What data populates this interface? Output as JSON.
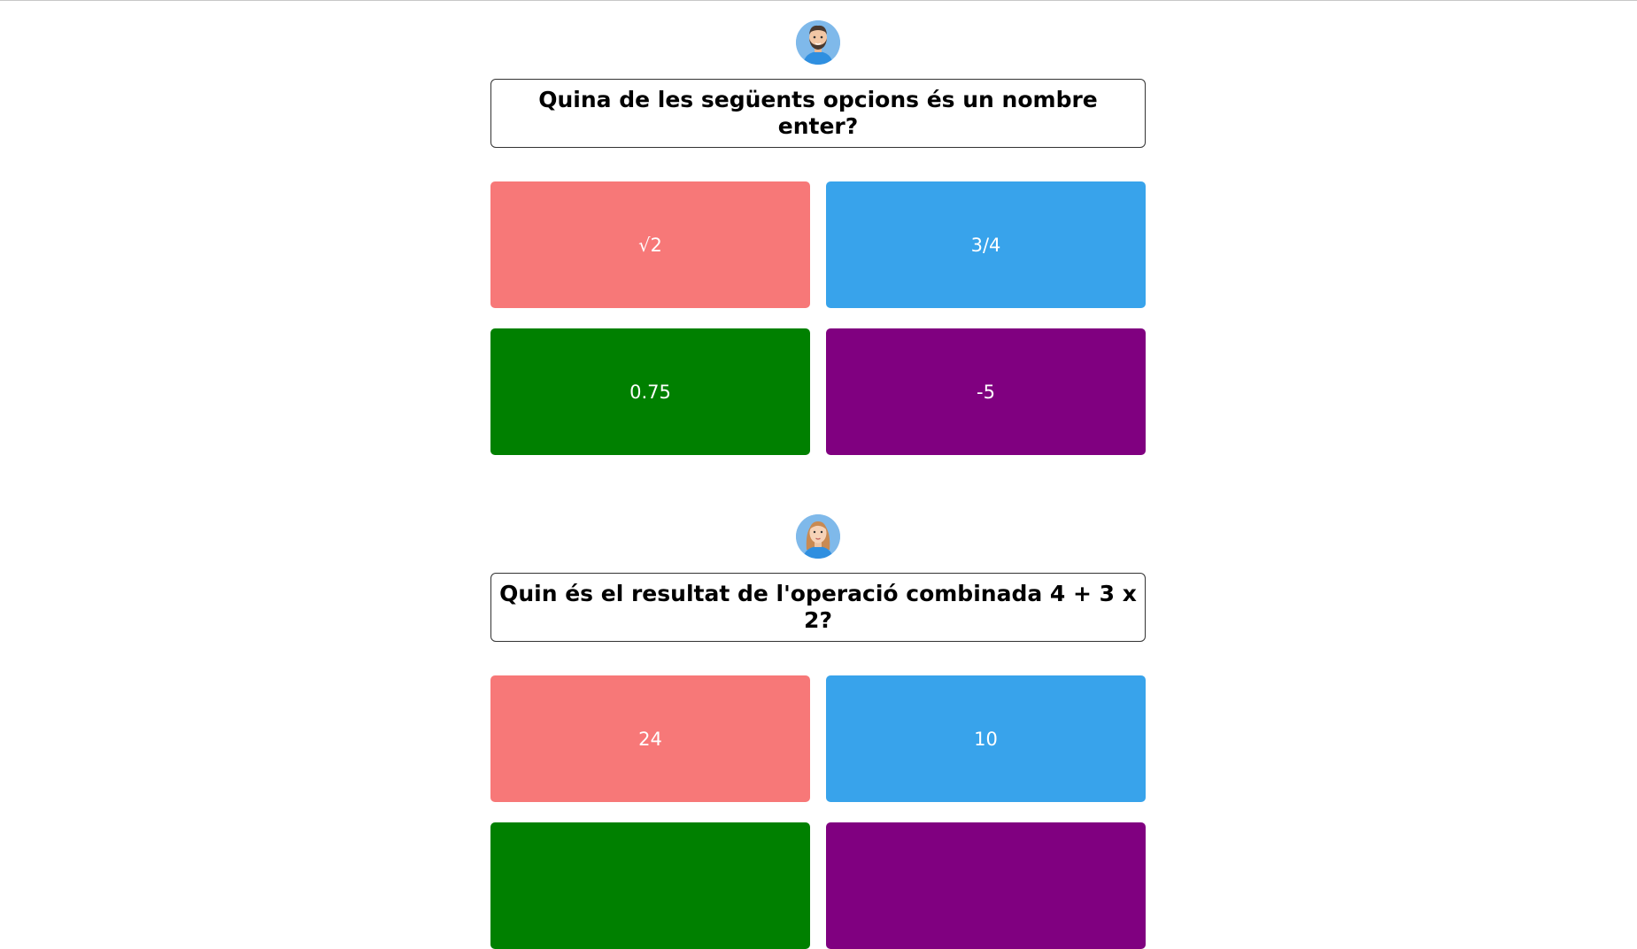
{
  "quiz": [
    {
      "avatar": "man-with-beard-avatar",
      "question": "Quina de les següents opcions és un nombre enter?",
      "answers": [
        {
          "label": "√2",
          "color": "#f77878"
        },
        {
          "label": "3/4",
          "color": "#38a3eb"
        },
        {
          "label": "0.75",
          "color": "#008000"
        },
        {
          "label": "-5",
          "color": "#800080"
        }
      ]
    },
    {
      "avatar": "woman-avatar",
      "question": "Quin és el resultat de l'operació combinada 4 + 3 x 2?",
      "answers": [
        {
          "label": "24",
          "color": "#f77878"
        },
        {
          "label": "10",
          "color": "#38a3eb"
        },
        {
          "label": "",
          "color": "#008000"
        },
        {
          "label": "",
          "color": "#800080"
        }
      ]
    }
  ]
}
